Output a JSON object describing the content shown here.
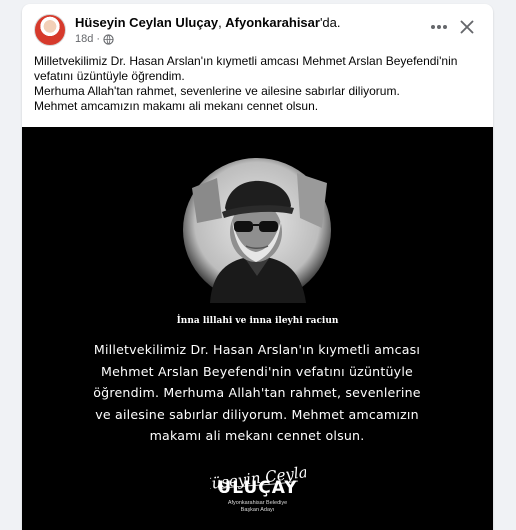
{
  "post": {
    "author_name": "Hüseyin Ceylan Uluçay",
    "separator": ", ",
    "location": "Afyonkarahisar",
    "location_suffix": "'da.",
    "time": "18d",
    "dot": "·",
    "more_icon": "more-horizontal-icon",
    "close_icon": "close-icon",
    "caption_lines": [
      "Milletvekilimiz Dr. Hasan Arslan'ın kıymetli amcası Mehmet Arslan Beyefendi'nin",
      "vefatını üzüntüyle öğrendim.",
      "Merhuma Allah'tan rahmet, sevenlerine ve ailesine sabırlar diliyorum.",
      "Mehmet amcamızın makamı ali mekanı cennet olsun."
    ]
  },
  "image": {
    "heading": "İnna lillahi ve inna ileyhi raciun",
    "quote_lines": [
      "Milletvekilimiz Dr. Hasan Arslan'ın kıymetli amcası",
      "Mehmet Arslan Beyefendi'nin vefatını üzüntüyle",
      "öğrendim. Merhuma Allah'tan rahmet, sevenlerine",
      "ve ailesine sabırlar diliyorum. Mehmet amcamızın",
      "makamı ali mekanı cennet olsun."
    ],
    "signature_text": "Hüseyin Ceylan",
    "logo_name": "ULUÇAY",
    "logo_role_line1": "Afyonkarahisar Belediye",
    "logo_role_line2": "Başkan Adayı"
  },
  "colors": {
    "card_bg": "#ffffff",
    "page_bg": "#f0f2f5",
    "meta_text": "#65676b",
    "image_bg": "#000000",
    "avatar_red": "#d63a2c"
  }
}
